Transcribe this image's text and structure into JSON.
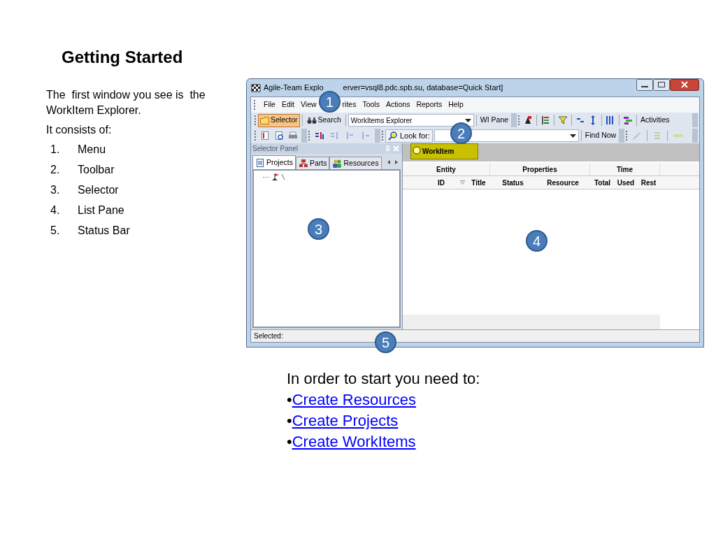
{
  "slide": {
    "title": "Getting Started",
    "intro": [
      "The  first window you see is  the WorkItem Explorer.",
      "It consists of:"
    ],
    "parts": [
      {
        "number": "1.",
        "label": "Menu"
      },
      {
        "number": "2.",
        "label": "Toolbar"
      },
      {
        "number": "3.",
        "label": "Selector"
      },
      {
        "number": "4.",
        "label": "List Pane"
      },
      {
        "number": "5.",
        "label": "Status Bar"
      }
    ],
    "footer": {
      "heading": "In order to start you need to:",
      "links": [
        {
          "bullet": "•",
          "label": "Create Resources"
        },
        {
          "bullet": "•",
          "label": "Create Projects"
        },
        {
          "bullet": "•",
          "label": "Create WorkItems"
        }
      ]
    }
  },
  "window": {
    "title_parts": [
      "Agile-Team Explo",
      "erver=vsql8.pdc.spb.su, database=Quick Start]"
    ],
    "menu": [
      "File",
      "Edit",
      "View",
      "rites",
      "Tools",
      "Actions",
      "Reports",
      "Help"
    ],
    "toolbar": {
      "buttons": [
        {
          "label": "Selector",
          "pressed": true
        },
        {
          "label": "Search",
          "pressed": false
        }
      ],
      "view_select": "WorkItems Explorer",
      "pane_button": "WI Pane",
      "activities_button": "Activities"
    },
    "search_bar": {
      "look_for_button": "Look for:",
      "find_button": "Find Now"
    },
    "selector_panel": {
      "title": "Selector Panel",
      "tabs": [
        {
          "label": "Projects",
          "selected": true
        },
        {
          "label": "Parts",
          "selected": false
        },
        {
          "label": "Resources",
          "selected": false
        }
      ]
    },
    "list_pane": {
      "tabs": [
        {
          "label": "WorkItem",
          "selected": true
        }
      ],
      "column_groups": [
        "Entity",
        "Properties",
        "Time"
      ],
      "columns": [
        "ID",
        "Title",
        "Status",
        "Resource",
        "Total",
        "Used",
        "Rest"
      ]
    },
    "status_bar": "Selected:"
  },
  "callouts": [
    "1",
    "2",
    "3",
    "4",
    "5"
  ]
}
